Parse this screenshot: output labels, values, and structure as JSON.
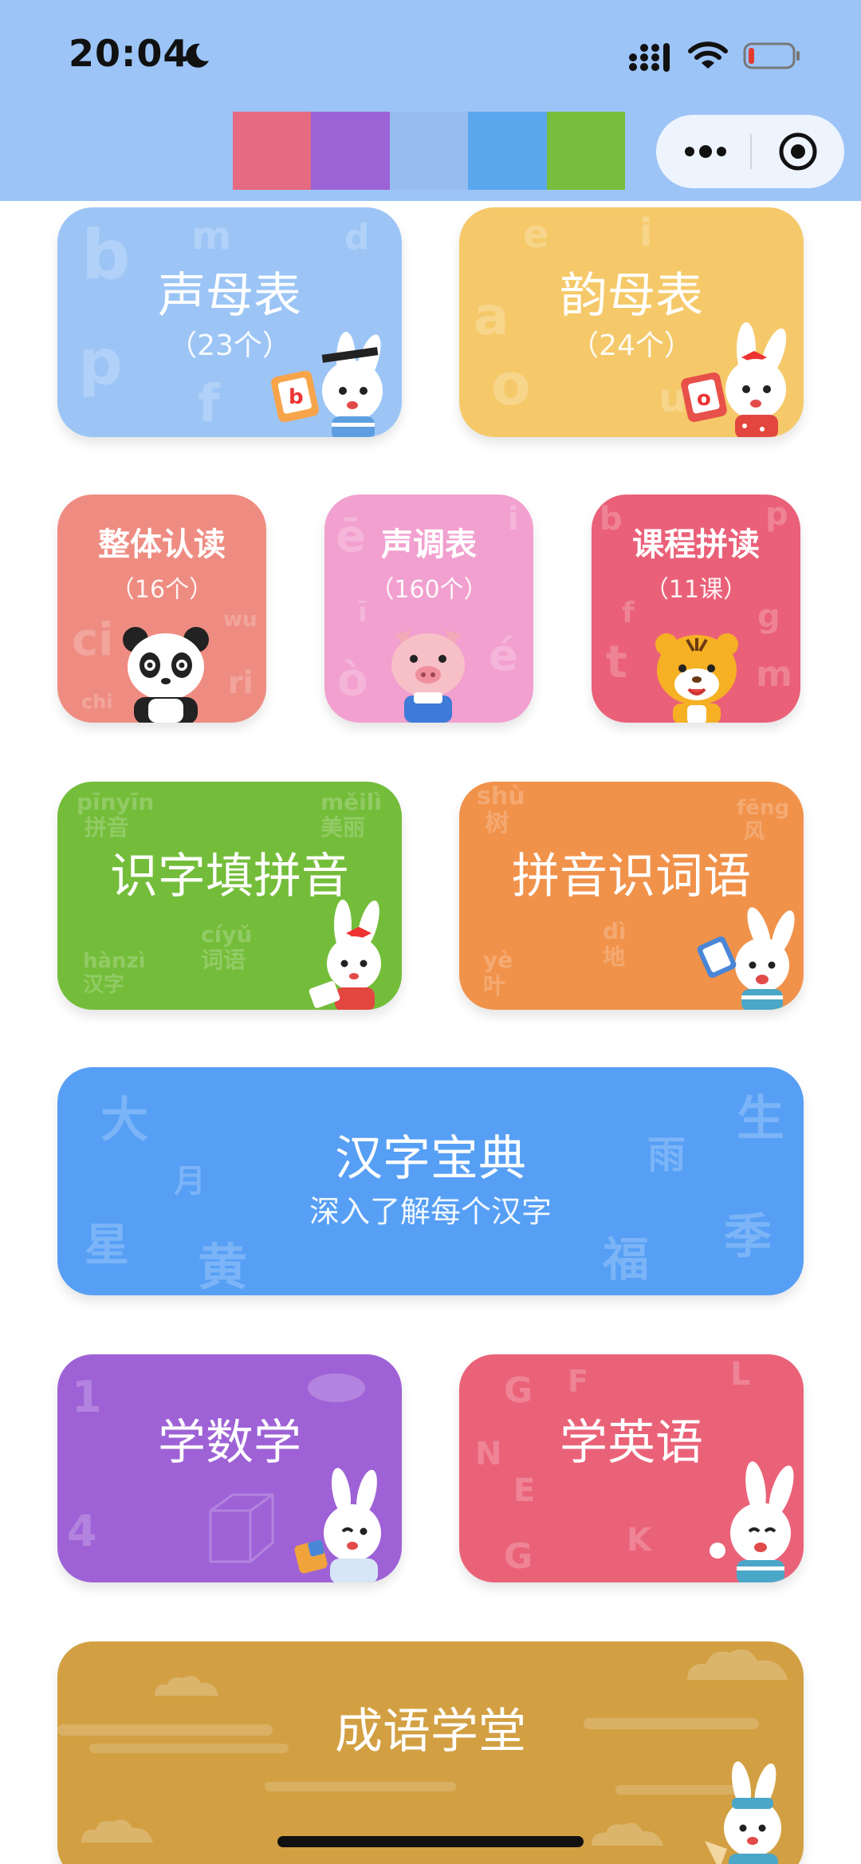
{
  "status_bar": {
    "time": "20:04"
  },
  "nav": {
    "swatch_colors": [
      "#e56a82",
      "#9c63d6",
      "#96bdee",
      "#5aa7ee",
      "#79bd3c"
    ]
  },
  "cards": {
    "shengmu": {
      "title": "声母表",
      "subtitle": "（23个）",
      "color": "#9cc5f6"
    },
    "yunmu": {
      "title": "韵母表",
      "subtitle": "（24个）",
      "color": "#f5c96a"
    },
    "zhengti": {
      "title": "整体认读",
      "subtitle": "（16个）",
      "color": "#ef8c82"
    },
    "shengdiao": {
      "title": "声调表",
      "subtitle": "（160个）",
      "color": "#f1a0cf"
    },
    "kecheng": {
      "title": "课程拼读",
      "subtitle": "（11课）",
      "color": "#ea6078"
    },
    "shizi": {
      "title": "识字填拼音",
      "color": "#74bd3a"
    },
    "ciyu": {
      "title": "拼音识词语",
      "color": "#f1924b"
    },
    "hanzi": {
      "title": "汉字宝典",
      "subtitle": "深入了解每个汉字",
      "color": "#569ff5"
    },
    "math": {
      "title": "学数学",
      "color": "#9e62d6"
    },
    "english": {
      "title": "学英语",
      "color": "#ea6278"
    },
    "chengyu": {
      "title": "成语学堂",
      "color": "#d2a043"
    }
  }
}
